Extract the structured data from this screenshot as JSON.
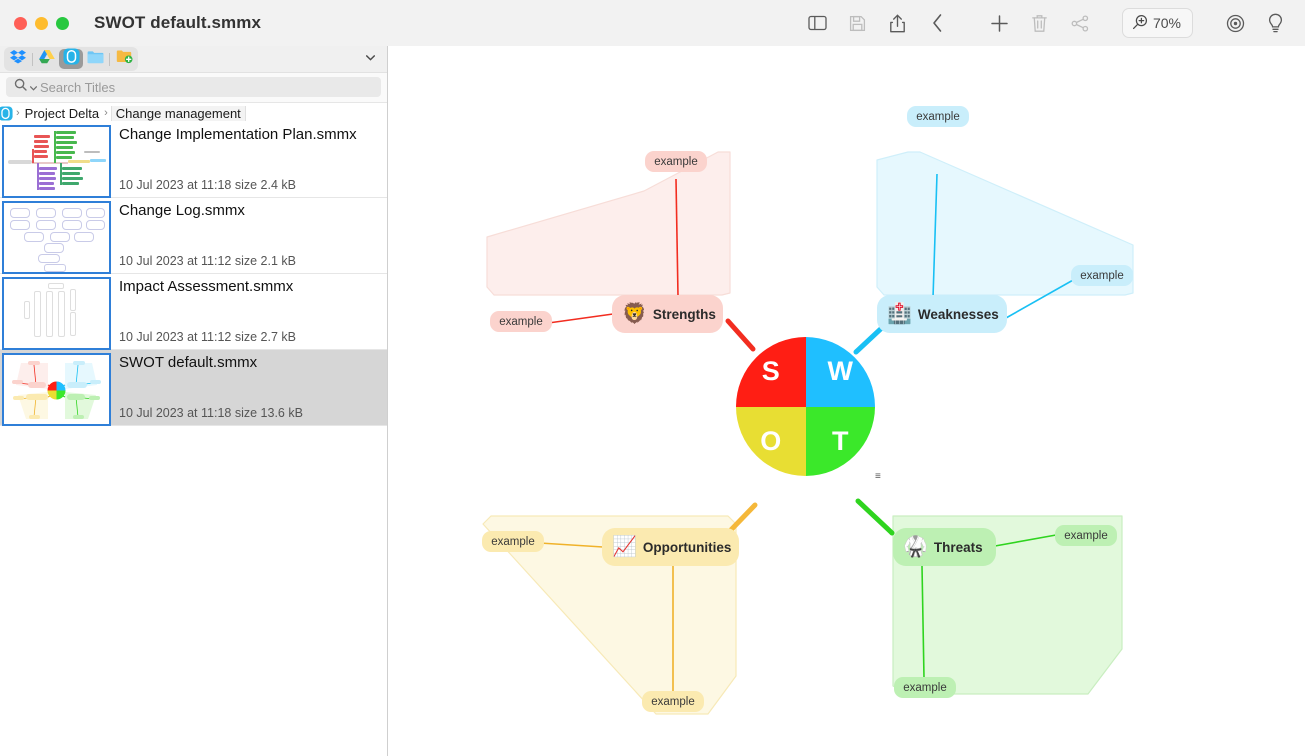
{
  "window": {
    "title": "SWOT default.smmx",
    "traffic_lights": [
      "close",
      "minimize",
      "maximize"
    ]
  },
  "toolbar": {
    "items": [
      {
        "name": "sidebar-toggle",
        "icon": "sidebar-icon",
        "label": "Sidebar",
        "enabled": true
      },
      {
        "name": "save-button",
        "icon": "floppy-disk-icon",
        "label": "Save",
        "enabled": false
      },
      {
        "name": "share-button",
        "icon": "share-up-icon",
        "label": "Share",
        "enabled": true
      },
      {
        "name": "back-button",
        "icon": "chevron-left-icon",
        "label": "Back",
        "enabled": true
      },
      {
        "name": "add-button",
        "icon": "plus-icon",
        "label": "Add",
        "enabled": true
      },
      {
        "name": "delete-button",
        "icon": "trash-icon",
        "label": "Delete",
        "enabled": false
      },
      {
        "name": "share-nodes-button",
        "icon": "share-nodes-icon",
        "label": "Share nodes",
        "enabled": false
      },
      {
        "name": "focus-button",
        "icon": "target-icon",
        "label": "Focus",
        "enabled": true
      },
      {
        "name": "hint-button",
        "icon": "lightbulb-icon",
        "label": "Hint",
        "enabled": true
      }
    ],
    "zoom_level": "70%"
  },
  "sidebar": {
    "sources": [
      {
        "name": "dropbox-icon",
        "label": "Dropbox",
        "selected": false
      },
      {
        "name": "google-drive-icon",
        "label": "Google Drive",
        "selected": false
      },
      {
        "name": "simplemind-cloud-icon",
        "label": "SimpleMind Cloud",
        "selected": true
      },
      {
        "name": "local-folder-icon",
        "label": "Local folder",
        "selected": false
      },
      {
        "name": "add-folder-icon",
        "label": "Add folder",
        "selected": false
      }
    ],
    "chevron_icon": "chevron-down-icon",
    "search": {
      "placeholder": "Search Titles",
      "value": "",
      "icon": "search-icon"
    },
    "breadcrumb": {
      "root_icon": "simplemind-cloud-icon",
      "separator": "›",
      "items": [
        "Project Delta",
        "Change management"
      ]
    },
    "files": [
      {
        "name": "Change Implementation Plan.smmx",
        "meta": "10 Jul 2023 at 11:18 size 2.4 kB",
        "selected": false,
        "thumb": "colorful-branching-map"
      },
      {
        "name": "Change Log.smmx",
        "meta": "10 Jul 2023 at 11:12 size 2.1 kB",
        "selected": false,
        "thumb": "pale-blue-outline-map"
      },
      {
        "name": "Impact Assessment.smmx",
        "meta": "10 Jul 2023 at 11:12 size 2.7 kB",
        "selected": false,
        "thumb": "faint-tree-map"
      },
      {
        "name": "SWOT default.smmx",
        "meta": "10 Jul 2023 at 11:18 size 13.6 kB",
        "selected": true,
        "thumb": "swot-map"
      }
    ]
  },
  "mindmap": {
    "center": {
      "name": "SWOT",
      "quadrants": [
        {
          "letter": "S",
          "color": "#ff1e14"
        },
        {
          "letter": "W",
          "color": "#1fbfff"
        },
        {
          "letter": "O",
          "color": "#e8de33"
        },
        {
          "letter": "T",
          "color": "#3be82a"
        }
      ]
    },
    "branches": [
      {
        "id": "strengths",
        "label": "Strengths",
        "emoji": "🦁",
        "emoji_name": "lion-face-icon",
        "line_color": "#f22d20",
        "node_fill": "#fbd3cd",
        "area_fill": "#fdeeec",
        "area_stroke": "#f7ddd8",
        "leaf_fill": "#fbd3cd",
        "children": [
          "example",
          "example"
        ]
      },
      {
        "id": "weaknesses",
        "label": "Weaknesses",
        "emoji": "🏥",
        "emoji_name": "hospital-icon",
        "line_color": "#19c0f4",
        "node_fill": "#c9eefb",
        "area_fill": "#e6f8fe",
        "area_stroke": "#cfeffa",
        "leaf_fill": "#c9eefb",
        "children": [
          "example",
          "example"
        ]
      },
      {
        "id": "opportunities",
        "label": "Opportunities",
        "emoji": "📈",
        "emoji_name": "chart-increasing-icon",
        "line_color": "#f0b22a",
        "node_fill": "#fbeab0",
        "area_fill": "#fdf8e3",
        "area_stroke": "#f7e9b7",
        "leaf_fill": "#fbeab0",
        "children": [
          "example",
          "example"
        ]
      },
      {
        "id": "threats",
        "label": "Threats",
        "emoji": "🥋",
        "emoji_name": "martial-arts-kick-icon",
        "line_color": "#2fd41f",
        "node_fill": "#bdf0b3",
        "area_fill": "#e2f9dc",
        "area_stroke": "#c9eec0",
        "leaf_fill": "#bdf0b3",
        "children": [
          "example",
          "example"
        ]
      }
    ],
    "marker_glyph": "≡"
  }
}
